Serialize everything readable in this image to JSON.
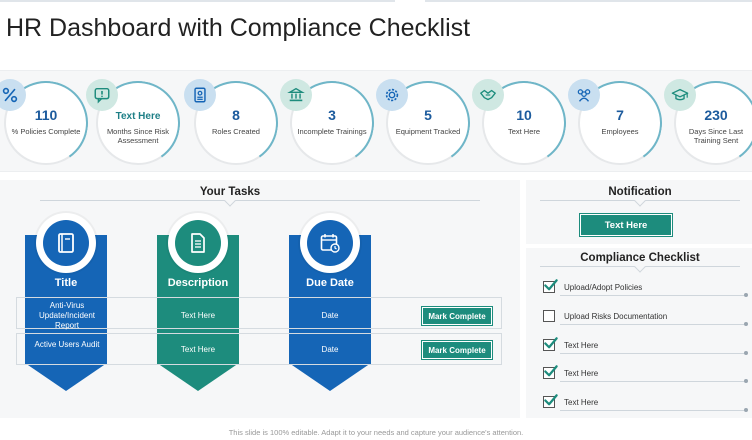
{
  "title": "HR Dashboard with Compliance Checklist",
  "colors": {
    "blue": "#1565b6",
    "teal": "#1d8c7d",
    "accent": "#6fb6c8"
  },
  "stats": [
    {
      "value": "110",
      "label": "% Policies Complete",
      "icon": "percent-icon",
      "badge": "#c9dff0"
    },
    {
      "value": "Text Here",
      "label": "Months Since Risk Assessment",
      "icon": "alert-icon",
      "badge": "#cfe8e2"
    },
    {
      "value": "8",
      "label": "Roles Created",
      "icon": "id-card-icon",
      "badge": "#c9dff0"
    },
    {
      "value": "3",
      "label": "Incomplete Trainings",
      "icon": "bank-icon",
      "badge": "#cfe8e2"
    },
    {
      "value": "5",
      "label": "Equipment Tracked",
      "icon": "gear-icon",
      "badge": "#c9dff0"
    },
    {
      "value": "10",
      "label": "Text Here",
      "icon": "handshake-icon",
      "badge": "#cfe8e2"
    },
    {
      "value": "7",
      "label": "Employees",
      "icon": "people-icon",
      "badge": "#c9dff0"
    },
    {
      "value": "230",
      "label": "Days Since Last Training Sent",
      "icon": "graduation-cap-icon",
      "badge": "#cfe8e2"
    }
  ],
  "tasks": {
    "heading": "Your Tasks",
    "columns": [
      {
        "header": "Title",
        "icon": "notebook-icon"
      },
      {
        "header": "Description",
        "icon": "document-icon"
      },
      {
        "header": "Due Date",
        "icon": "calendar-clock-icon"
      }
    ],
    "rows": [
      {
        "title": "Anti-Virus Update/Incident Report",
        "description": "Text Here",
        "due": "Date",
        "action": "Mark Complete"
      },
      {
        "title": "Active Users Audit",
        "description": "Text Here",
        "due": "Date",
        "action": "Mark Complete"
      }
    ]
  },
  "notification": {
    "heading": "Notification",
    "button": "Text Here"
  },
  "checklist": {
    "heading": "Compliance Checklist",
    "items": [
      {
        "label": "Upload/Adopt  Policies",
        "checked": true
      },
      {
        "label": "Upload  Risks Documentation",
        "checked": false
      },
      {
        "label": "Text Here",
        "checked": true
      },
      {
        "label": "Text Here",
        "checked": true
      },
      {
        "label": "Text Here",
        "checked": true
      }
    ]
  },
  "footer": "This slide is 100% editable. Adapt it to your needs and capture your audience's attention."
}
